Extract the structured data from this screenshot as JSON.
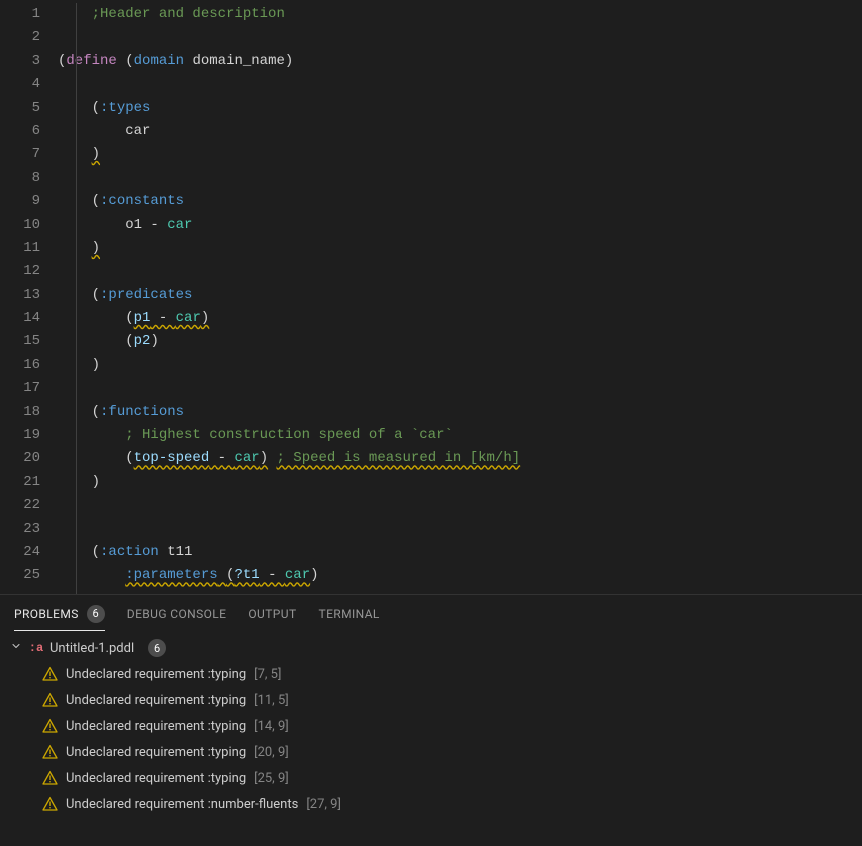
{
  "gutter": {
    "start": 1,
    "end": 25
  },
  "code": {
    "line1_comment": ";Header and description",
    "line3_define": "define",
    "line3_domain": "domain",
    "line3_domain_name": "domain_name",
    "line5_kw": ":types",
    "line6_type": "car",
    "line9_kw": ":constants",
    "line10_const": "o1",
    "line10_dash": " - ",
    "line10_type": "car",
    "line13_kw": ":predicates",
    "line14_p": "p1",
    "line14_dash": " - ",
    "line14_type": "car",
    "line15_p": "p2",
    "line18_kw": ":functions",
    "line19_comment": "; Highest construction speed of a `car`",
    "line20_fn": "top-speed",
    "line20_dash": " - ",
    "line20_type": "car",
    "line20_comment": "; Speed is measured in [km/h]",
    "line24_kw": ":action",
    "line24_name": "t11",
    "line25_kw": ":parameters",
    "line25_var": "?t1",
    "line25_dash": " - ",
    "line25_type": "car"
  },
  "panel": {
    "tabs": {
      "problems": "PROBLEMS",
      "problems_badge": "6",
      "debug_console": "DEBUG CONSOLE",
      "output": "OUTPUT",
      "terminal": "TERMINAL"
    },
    "file": {
      "icon_text": ":a",
      "name": "Untitled-1.pddl",
      "badge": "6"
    },
    "problems": [
      {
        "msg": "Undeclared requirement :typing",
        "loc": "[7, 5]"
      },
      {
        "msg": "Undeclared requirement :typing",
        "loc": "[11, 5]"
      },
      {
        "msg": "Undeclared requirement :typing",
        "loc": "[14, 9]"
      },
      {
        "msg": "Undeclared requirement :typing",
        "loc": "[20, 9]"
      },
      {
        "msg": "Undeclared requirement :typing",
        "loc": "[25, 9]"
      },
      {
        "msg": "Undeclared requirement :number-fluents",
        "loc": "[27, 9]"
      }
    ]
  }
}
